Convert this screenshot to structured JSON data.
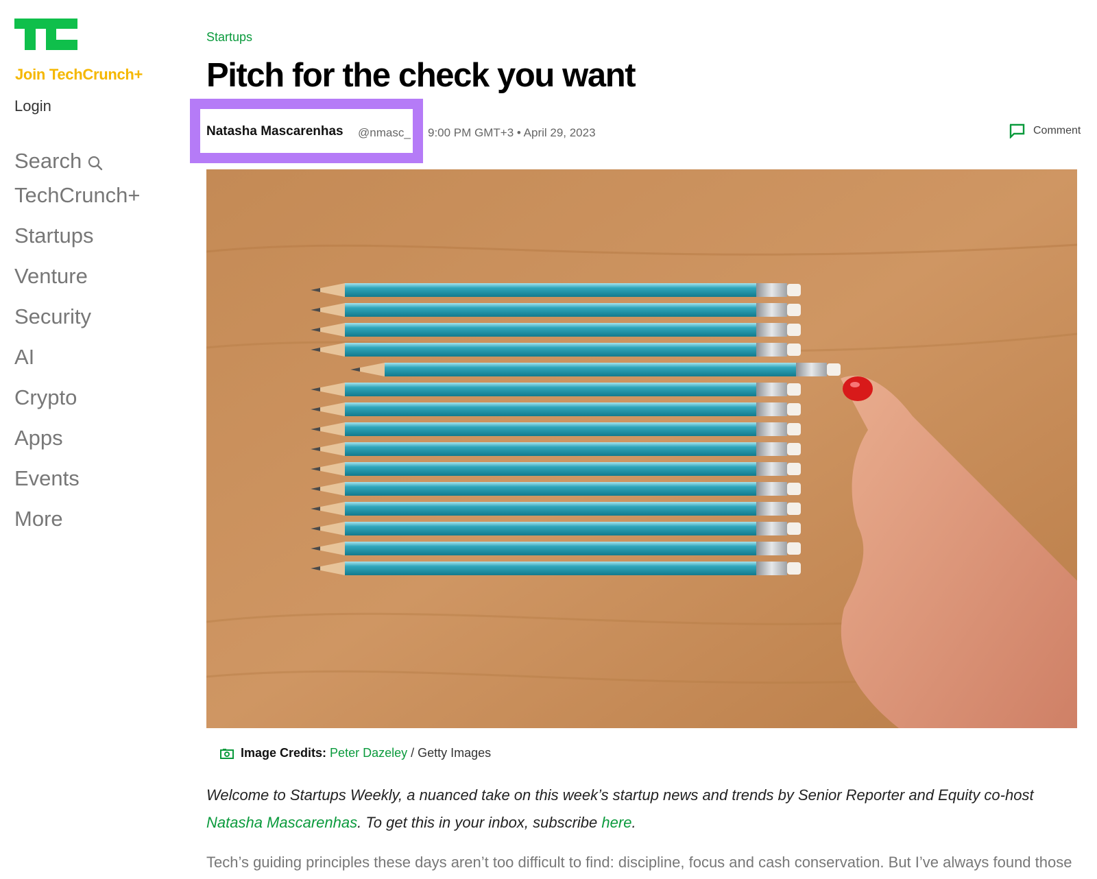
{
  "sidebar": {
    "join_label": "Join TechCrunch+",
    "login_label": "Login",
    "nav": [
      {
        "label": "Search"
      },
      {
        "label": "TechCrunch+"
      },
      {
        "label": "Startups"
      },
      {
        "label": "Venture"
      },
      {
        "label": "Security"
      },
      {
        "label": "AI"
      },
      {
        "label": "Crypto"
      },
      {
        "label": "Apps"
      },
      {
        "label": "Events"
      },
      {
        "label": "More"
      }
    ]
  },
  "article": {
    "category": "Startups",
    "title": "Pitch for the check you want",
    "author": "Natasha Mascarenhas",
    "handle": "@nmasc_",
    "datetime": "9:00 PM GMT+3 • April 29, 2023",
    "comment_label": "Comment",
    "image_credits": {
      "label": "Image Credits:",
      "name": "Peter Dazeley",
      "separator": "/",
      "source": "Getty Images"
    },
    "intro": {
      "part1": "Welcome to Startups Weekly, a nuanced take on this week’s startup news and trends by Senior Reporter and Equity co-host ",
      "author_link": "Natasha Mascarenhas",
      "part2": ". To get this in your inbox, subscribe ",
      "subscribe_link": "here",
      "part3": "."
    },
    "body_first_line": "Tech’s guiding principles these days aren’t too difficult to find: discipline, focus and cash conservation. But I’ve always found those"
  },
  "colors": {
    "brand_green": "#0a9a3c",
    "join_yellow": "#f5b700",
    "highlight_purple": "#b57bf7"
  },
  "icons": [
    "techcrunch-logo",
    "search-icon",
    "comment-icon",
    "camera-icon"
  ]
}
